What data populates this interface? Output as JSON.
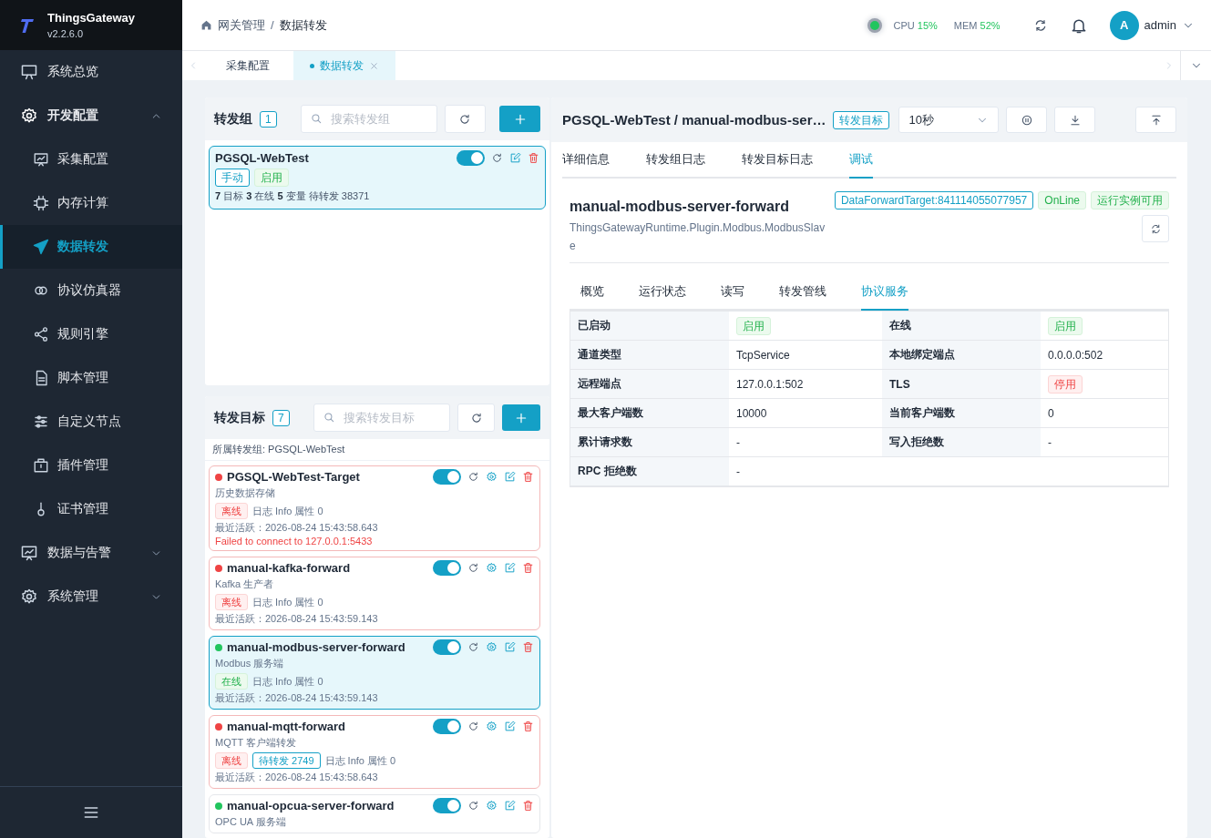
{
  "app": {
    "name": "ThingsGateway",
    "version": "v2.2.6.0"
  },
  "sidebar": {
    "items": [
      {
        "label": "系统总览"
      },
      {
        "label": "开发配置",
        "expanded": true,
        "children": [
          {
            "label": "采集配置",
            "selected": false
          },
          {
            "label": "内存计算",
            "selected": false
          },
          {
            "label": "数据转发",
            "selected": true
          },
          {
            "label": "协议仿真器",
            "selected": false
          },
          {
            "label": "规则引擎",
            "selected": false
          },
          {
            "label": "脚本管理",
            "selected": false
          },
          {
            "label": "自定义节点",
            "selected": false
          },
          {
            "label": "插件管理",
            "selected": false
          },
          {
            "label": "证书管理",
            "selected": false
          }
        ]
      },
      {
        "label": "数据与告警",
        "expanded": false
      },
      {
        "label": "系统管理",
        "expanded": false
      }
    ]
  },
  "header": {
    "breadcrumb": [
      "网关管理",
      "数据转发"
    ],
    "breadcrumb_separator": "/",
    "cpu": {
      "label": "CPU",
      "value": "15%"
    },
    "mem": {
      "label": "MEM",
      "value": "52%"
    },
    "user": {
      "initial": "A",
      "name": "admin"
    }
  },
  "page_tabs": [
    {
      "label": "采集配置",
      "selected": false
    },
    {
      "label": "数据转发",
      "selected": true
    }
  ],
  "groups": {
    "title": "转发组",
    "count": "1",
    "placeholder": "搜索转发组",
    "items": [
      {
        "name": "PGSQL-WebTest",
        "selected": true,
        "on": true,
        "tags": [
          {
            "text": "手动",
            "kind": "outline"
          },
          {
            "text": "启用",
            "kind": "success"
          }
        ],
        "stats": "**7** 目标 **3** 在线 **5** 变量 待转发 38371"
      }
    ]
  },
  "targets": {
    "title": "转发目标",
    "count": "7",
    "placeholder": "搜索转发目标",
    "group_label": "所属转发组: PGSQL-WebTest",
    "items": [
      {
        "name": "PGSQL-WebTest-Target",
        "online": false,
        "selected": false,
        "on": true,
        "subtitle": "历史数据存储",
        "status": "离线",
        "meta": "日志 Info 属性 0",
        "last_active": "最近活跃：2026-08-24 15:43:58.643",
        "error": "Failed to connect to 127.0.0.1:5433"
      },
      {
        "name": "manual-kafka-forward",
        "online": false,
        "selected": false,
        "on": true,
        "subtitle": "Kafka 生产者",
        "status": "离线",
        "meta": "日志 Info 属性 0",
        "last_active": "最近活跃：2026-08-24 15:43:59.143"
      },
      {
        "name": "manual-modbus-server-forward",
        "online": true,
        "selected": true,
        "on": true,
        "subtitle": "Modbus 服务端",
        "status": "在线",
        "meta": "日志 Info 属性 0",
        "last_active": "最近活跃：2026-08-24 15:43:59.143"
      },
      {
        "name": "manual-mqtt-forward",
        "online": false,
        "selected": false,
        "on": true,
        "subtitle": "MQTT 客户端转发",
        "status": "离线",
        "pending": "待转发 2749",
        "meta": "日志 Info 属性 0",
        "last_active": "最近活跃：2026-08-24 15:43:58.643"
      },
      {
        "name": "manual-opcua-server-forward",
        "online": true,
        "selected": false,
        "on": true,
        "subtitle": "OPC UA 服务端"
      }
    ]
  },
  "detail": {
    "title": "PGSQL-WebTest / manual-modbus-ser…",
    "tag": "转发目标",
    "interval": "10秒",
    "tabs": [
      {
        "label": "详细信息",
        "selected": false
      },
      {
        "label": "转发组日志",
        "selected": false
      },
      {
        "label": "转发目标日志",
        "selected": false
      },
      {
        "label": "调试",
        "selected": true
      }
    ],
    "name": "manual-modbus-server-forward",
    "type_path": "ThingsGatewayRuntime.Plugin.Modbus.ModbusSlave",
    "badges": [
      {
        "text": "DataForwardTarget:841114055077957",
        "kind": "outline"
      },
      {
        "text": "OnLine",
        "kind": "success"
      },
      {
        "text": "运行实例可用",
        "kind": "success"
      }
    ],
    "subtabs": [
      {
        "label": "概览",
        "selected": false
      },
      {
        "label": "运行状态",
        "selected": false
      },
      {
        "label": "读写",
        "selected": false
      },
      {
        "label": "转发管线",
        "selected": false
      },
      {
        "label": "协议服务",
        "selected": true
      }
    ],
    "fields": [
      {
        "label": "已启动",
        "value": "启用",
        "kind": "tag",
        "on": true
      },
      {
        "label": "在线",
        "value": "启用",
        "kind": "tag",
        "on": true
      },
      {
        "label": "通道类型",
        "value": "TcpService",
        "kind": "text"
      },
      {
        "label": "本地绑定端点",
        "value": "0.0.0.0:502",
        "kind": "text"
      },
      {
        "label": "远程端点",
        "value": "127.0.0.1:502",
        "kind": "text"
      },
      {
        "label": "TLS",
        "value": "停用",
        "kind": "tag",
        "on": false
      },
      {
        "label": "最大客户端数",
        "value": "10000",
        "kind": "text"
      },
      {
        "label": "当前客户端数",
        "value": "0",
        "kind": "text"
      },
      {
        "label": "累计请求数",
        "value": "-",
        "kind": "text"
      },
      {
        "label": "写入拒绝数",
        "value": "-",
        "kind": "text"
      },
      {
        "label": "RPC 拒绝数",
        "value": "-",
        "kind": "text"
      }
    ]
  }
}
